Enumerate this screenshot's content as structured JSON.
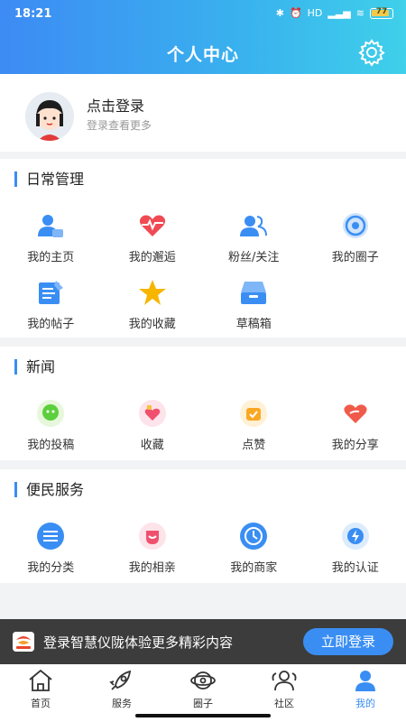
{
  "status_bar": {
    "time": "18:21",
    "network": "HD",
    "battery_level": "77"
  },
  "header": {
    "title": "个人中心",
    "settings_icon": "gear-icon"
  },
  "profile": {
    "name": "点击登录",
    "subtitle": "登录查看更多",
    "avatar_icon": "avatar-cartoon-girl"
  },
  "daily": {
    "title": "日常管理",
    "items": [
      {
        "label": "我的主页",
        "icon": "user-card-icon"
      },
      {
        "label": "我的邂逅",
        "icon": "heartbeat-icon"
      },
      {
        "label": "粉丝/关注",
        "icon": "users-icon"
      },
      {
        "label": "我的圈子",
        "icon": "circle-target-icon"
      },
      {
        "label": "我的帖子",
        "icon": "post-edit-icon"
      },
      {
        "label": "我的收藏",
        "icon": "star-icon"
      },
      {
        "label": "草稿箱",
        "icon": "drafts-tray-icon"
      }
    ]
  },
  "news": {
    "title": "新闻",
    "items": [
      {
        "label": "我的投稿",
        "icon": "submission-icon"
      },
      {
        "label": "收藏",
        "icon": "favorite-heart-icon"
      },
      {
        "label": "点赞",
        "icon": "like-icon"
      },
      {
        "label": "我的分享",
        "icon": "share-heart-icon"
      }
    ]
  },
  "services": {
    "title": "便民服务",
    "items": [
      {
        "label": "我的分类",
        "icon": "category-list-icon"
      },
      {
        "label": "我的相亲",
        "icon": "matchmaking-icon"
      },
      {
        "label": "我的商家",
        "icon": "merchant-clock-icon"
      },
      {
        "label": "我的认证",
        "icon": "verify-bolt-icon"
      }
    ]
  },
  "login_banner": {
    "text": "登录智慧仪陇体验更多精彩内容",
    "button": "立即登录",
    "logo_text": "智慧仪陇"
  },
  "tabbar": {
    "items": [
      {
        "label": "首页",
        "icon": "home-icon"
      },
      {
        "label": "服务",
        "icon": "rocket-icon"
      },
      {
        "label": "圈子",
        "icon": "planet-icon"
      },
      {
        "label": "社区",
        "icon": "community-icon"
      },
      {
        "label": "我的",
        "icon": "profile-icon"
      }
    ],
    "active": "我的"
  },
  "colors": {
    "accent": "#3a8ef3",
    "banner_bg": "#3c3c3c",
    "page_bg": "#f2f3f5"
  }
}
